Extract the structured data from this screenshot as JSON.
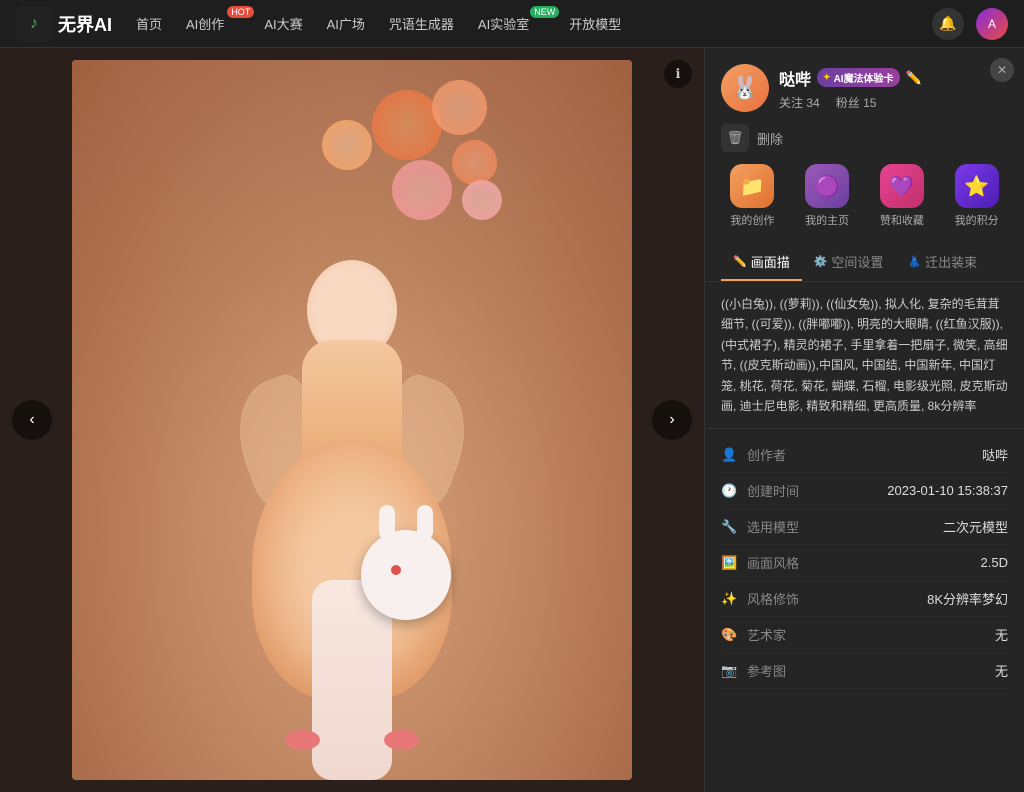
{
  "nav": {
    "logo_text": "无界AI",
    "items": [
      {
        "label": "首页",
        "badge": null
      },
      {
        "label": "AI创作",
        "badge": "HOT",
        "badge_type": "red"
      },
      {
        "label": "AI大赛",
        "badge": null
      },
      {
        "label": "AI广场",
        "badge": null
      },
      {
        "label": "咒语生成器",
        "badge": null
      },
      {
        "label": "AI实验室",
        "badge": "NEW",
        "badge_type": "green"
      },
      {
        "label": "开放模型",
        "badge": null
      }
    ]
  },
  "user": {
    "name": "哒哔",
    "magic_badge": "AI魔法体验卡",
    "followers": "34",
    "fans": "15",
    "follow_label": "关注",
    "fans_label": "粉丝"
  },
  "action": {
    "delete_label": "删除"
  },
  "quick_nav": [
    {
      "label": "我的创作",
      "icon": "📁"
    },
    {
      "label": "我的主页",
      "icon": "🟣"
    },
    {
      "label": "赞和收藏",
      "icon": "💜"
    },
    {
      "label": "我的积分",
      "icon": "⭐"
    }
  ],
  "tabs": [
    {
      "label": "画面描",
      "icon": "✏️",
      "active": true
    },
    {
      "label": "空间设置",
      "icon": "⚙️"
    },
    {
      "label": "迁出装束",
      "icon": "👗"
    }
  ],
  "prompt": "((小白兔)), ((萝莉)), ((仙女兔)), 拟人化, 复杂的毛茸茸细节, ((可爱)), ((胖嘟嘟)), 明亮的大眼睛, ((红鱼汉服)), (中式裙子), 精灵的裙子, 手里拿着一把扇子, 微笑, 高细节, ((皮克斯动画)),中国风, 中国结, 中国新年, 中国灯笼, 桃花, 荷花, 菊花, 蝴蝶, 石榴, 电影级光照, 皮克斯动画, 迪士尼电影, 精致和精细, 更高质量, 8k分辨率",
  "info_rows": [
    {
      "icon": "👤",
      "label": "创作者",
      "value": "哒哔"
    },
    {
      "icon": "🕐",
      "label": "创建时间",
      "value": "2023-01-10 15:38:37"
    },
    {
      "icon": "🔧",
      "label": "选用模型",
      "value": "二次元模型"
    },
    {
      "icon": "🖼️",
      "label": "画面风格",
      "value": "2.5D"
    },
    {
      "icon": "✨",
      "label": "风格修饰",
      "value": "8K分辨率梦幻"
    },
    {
      "icon": "🎨",
      "label": "艺术家",
      "value": "无"
    },
    {
      "icon": "📷",
      "label": "参考图",
      "value": "无"
    }
  ],
  "arrows": {
    "left": "‹",
    "right": "›"
  },
  "info_btn": "ℹ"
}
